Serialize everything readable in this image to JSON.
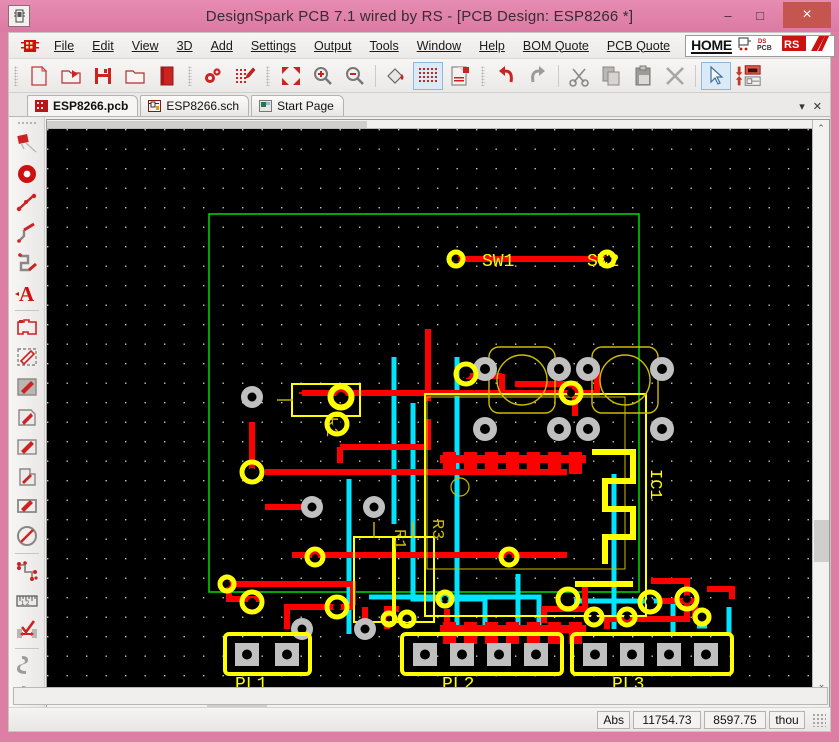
{
  "window": {
    "title": "DesignSpark PCB 7.1 wired by RS - [PCB Design: ESP8266 *]",
    "app_icon": "pcb-app-icon",
    "minimize": "–",
    "maximize": "□",
    "close": "×",
    "frame_color": "#dd7fa5",
    "close_color": "#c5564f"
  },
  "menu": {
    "icon": "designspark-logo-icon",
    "items": [
      {
        "label": "File",
        "accel": "F"
      },
      {
        "label": "Edit",
        "accel": "E"
      },
      {
        "label": "View",
        "accel": "V"
      },
      {
        "label": "3D",
        "accel": "3"
      },
      {
        "label": "Add",
        "accel": "A"
      },
      {
        "label": "Settings",
        "accel": "S"
      },
      {
        "label": "Output",
        "accel": "O"
      },
      {
        "label": "Tools",
        "accel": "T"
      },
      {
        "label": "Window",
        "accel": "W"
      },
      {
        "label": "Help",
        "accel": "H"
      }
    ],
    "bom_quote": "BOM Quote",
    "pcb_quote": "PCB Quote",
    "brand": {
      "home": "HOME",
      "ds_pcb": "DS PCB",
      "rs": "RS",
      "alpha": "A"
    },
    "mdi_minimize": "–",
    "mdi_restore": "❐",
    "mdi_close": "×"
  },
  "toolbar": {
    "groups": [
      {
        "buttons": [
          {
            "name": "new-design-button",
            "title": "New"
          },
          {
            "name": "open-design-button",
            "title": "Open"
          },
          {
            "name": "save-design-button",
            "title": "Save"
          },
          {
            "name": "open-library-button",
            "title": "Open Library"
          },
          {
            "name": "library-manager-button",
            "title": "Library Manager"
          }
        ]
      },
      {
        "buttons": [
          {
            "name": "design-settings-button",
            "title": "Design Technology"
          },
          {
            "name": "edit-grid-button",
            "title": "Grid Settings"
          }
        ]
      },
      {
        "buttons": [
          {
            "name": "zoom-fit-button",
            "title": "Zoom to Fit"
          },
          {
            "name": "zoom-in-button",
            "title": "Zoom In"
          },
          {
            "name": "zoom-out-button",
            "title": "Zoom Out"
          }
        ]
      },
      {
        "buttons": [
          {
            "name": "colours-button",
            "title": "Colours"
          },
          {
            "name": "grid-toggle-button",
            "title": "Toggle Grid",
            "selected": true
          },
          {
            "name": "layers-button",
            "title": "Layers"
          }
        ]
      },
      {
        "buttons": [
          {
            "name": "undo-button",
            "title": "Undo"
          },
          {
            "name": "redo-button",
            "title": "Redo"
          },
          {
            "name": "cut-button",
            "title": "Cut"
          },
          {
            "name": "copy-button",
            "title": "Copy"
          },
          {
            "name": "paste-button",
            "title": "Paste"
          },
          {
            "name": "delete-button",
            "title": "Delete"
          }
        ]
      },
      {
        "buttons": [
          {
            "name": "select-tool-button",
            "title": "Select",
            "selected": true
          },
          {
            "name": "swap-layers-button",
            "title": "Swap / Component Side"
          }
        ]
      }
    ]
  },
  "tabs": {
    "items": [
      {
        "label": "ESP8266.pcb",
        "icon": "pcb-doc-icon",
        "active": true
      },
      {
        "label": "ESP8266.sch",
        "icon": "sch-doc-icon",
        "active": false
      },
      {
        "label": "Start Page",
        "icon": "start-page-icon",
        "active": false
      }
    ],
    "list_button": "▾",
    "close_button": "✕"
  },
  "left_toolbar": {
    "items": [
      {
        "name": "add-component-button",
        "title": "Add Component"
      },
      {
        "name": "add-pad-button",
        "title": "Add Pad"
      },
      {
        "name": "add-connection-button",
        "title": "Add Connection"
      },
      {
        "name": "add-track-button",
        "title": "Add Track"
      },
      {
        "name": "add-route-button",
        "title": "Add Route"
      },
      {
        "name": "add-text-button",
        "title": "Add Text"
      },
      {
        "name": "add-board-button",
        "title": "Add Board"
      },
      {
        "name": "add-area-button",
        "title": "Add Area"
      },
      {
        "name": "add-copper-button",
        "title": "Add Copper"
      },
      {
        "name": "add-copper-pour-button",
        "title": "Add Copper Pour"
      },
      {
        "name": "add-shape-button",
        "title": "Add Shape"
      },
      {
        "name": "add-cutout-button",
        "title": "Add Cutout"
      },
      {
        "name": "add-keepout-button",
        "title": "Add Keep Out Area"
      },
      {
        "name": "autoroute-button",
        "title": "Auto Route Nets"
      },
      {
        "name": "measure-button",
        "title": "Measure"
      },
      {
        "name": "drc-check-button",
        "title": "Design Rule Check"
      },
      {
        "name": "footprint-1-button",
        "title": "Footprint Tool"
      },
      {
        "name": "footprint-2-button",
        "title": "Footprint Tool"
      }
    ]
  },
  "canvas": {
    "background": "#000000",
    "grid_dot_color": "#c8c8c8",
    "board_outline_color": "#00d000",
    "silkscreen_color": "#ffff00",
    "top_copper_color": "#ff0000",
    "bottom_copper_color": "#00e5ff",
    "pad_color": "#c0c0c0",
    "via_color": "#ffff00",
    "components": [
      {
        "ref": "IC1",
        "type": "esp8266-module"
      },
      {
        "ref": "SW1",
        "type": "tact-switch"
      },
      {
        "ref": "SW2",
        "type": "tact-switch"
      },
      {
        "ref": "R1",
        "type": "resistor"
      },
      {
        "ref": "R2",
        "type": "resistor"
      },
      {
        "ref": "R3",
        "type": "resistor"
      },
      {
        "ref": "PL1",
        "type": "header-2way"
      },
      {
        "ref": "PL2",
        "type": "header-4way"
      },
      {
        "ref": "PL3",
        "type": "header-4way"
      }
    ]
  },
  "scrollbars": {
    "up_arrow": "⌃",
    "down_arrow": "⌄",
    "left_arrow": "‹",
    "right_arrow": "›"
  },
  "command_bar": {
    "text": ""
  },
  "status_bar": {
    "mode": "Abs",
    "x": "11754.73",
    "y": "8597.75",
    "units": "thou"
  }
}
